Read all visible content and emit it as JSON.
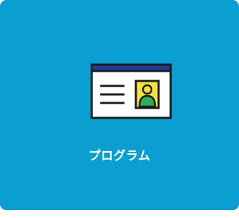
{
  "tile": {
    "label": "プログラム",
    "icon": "program-window-profile-icon",
    "background_color": "#0a9fd0",
    "label_color": "#ffffff"
  }
}
